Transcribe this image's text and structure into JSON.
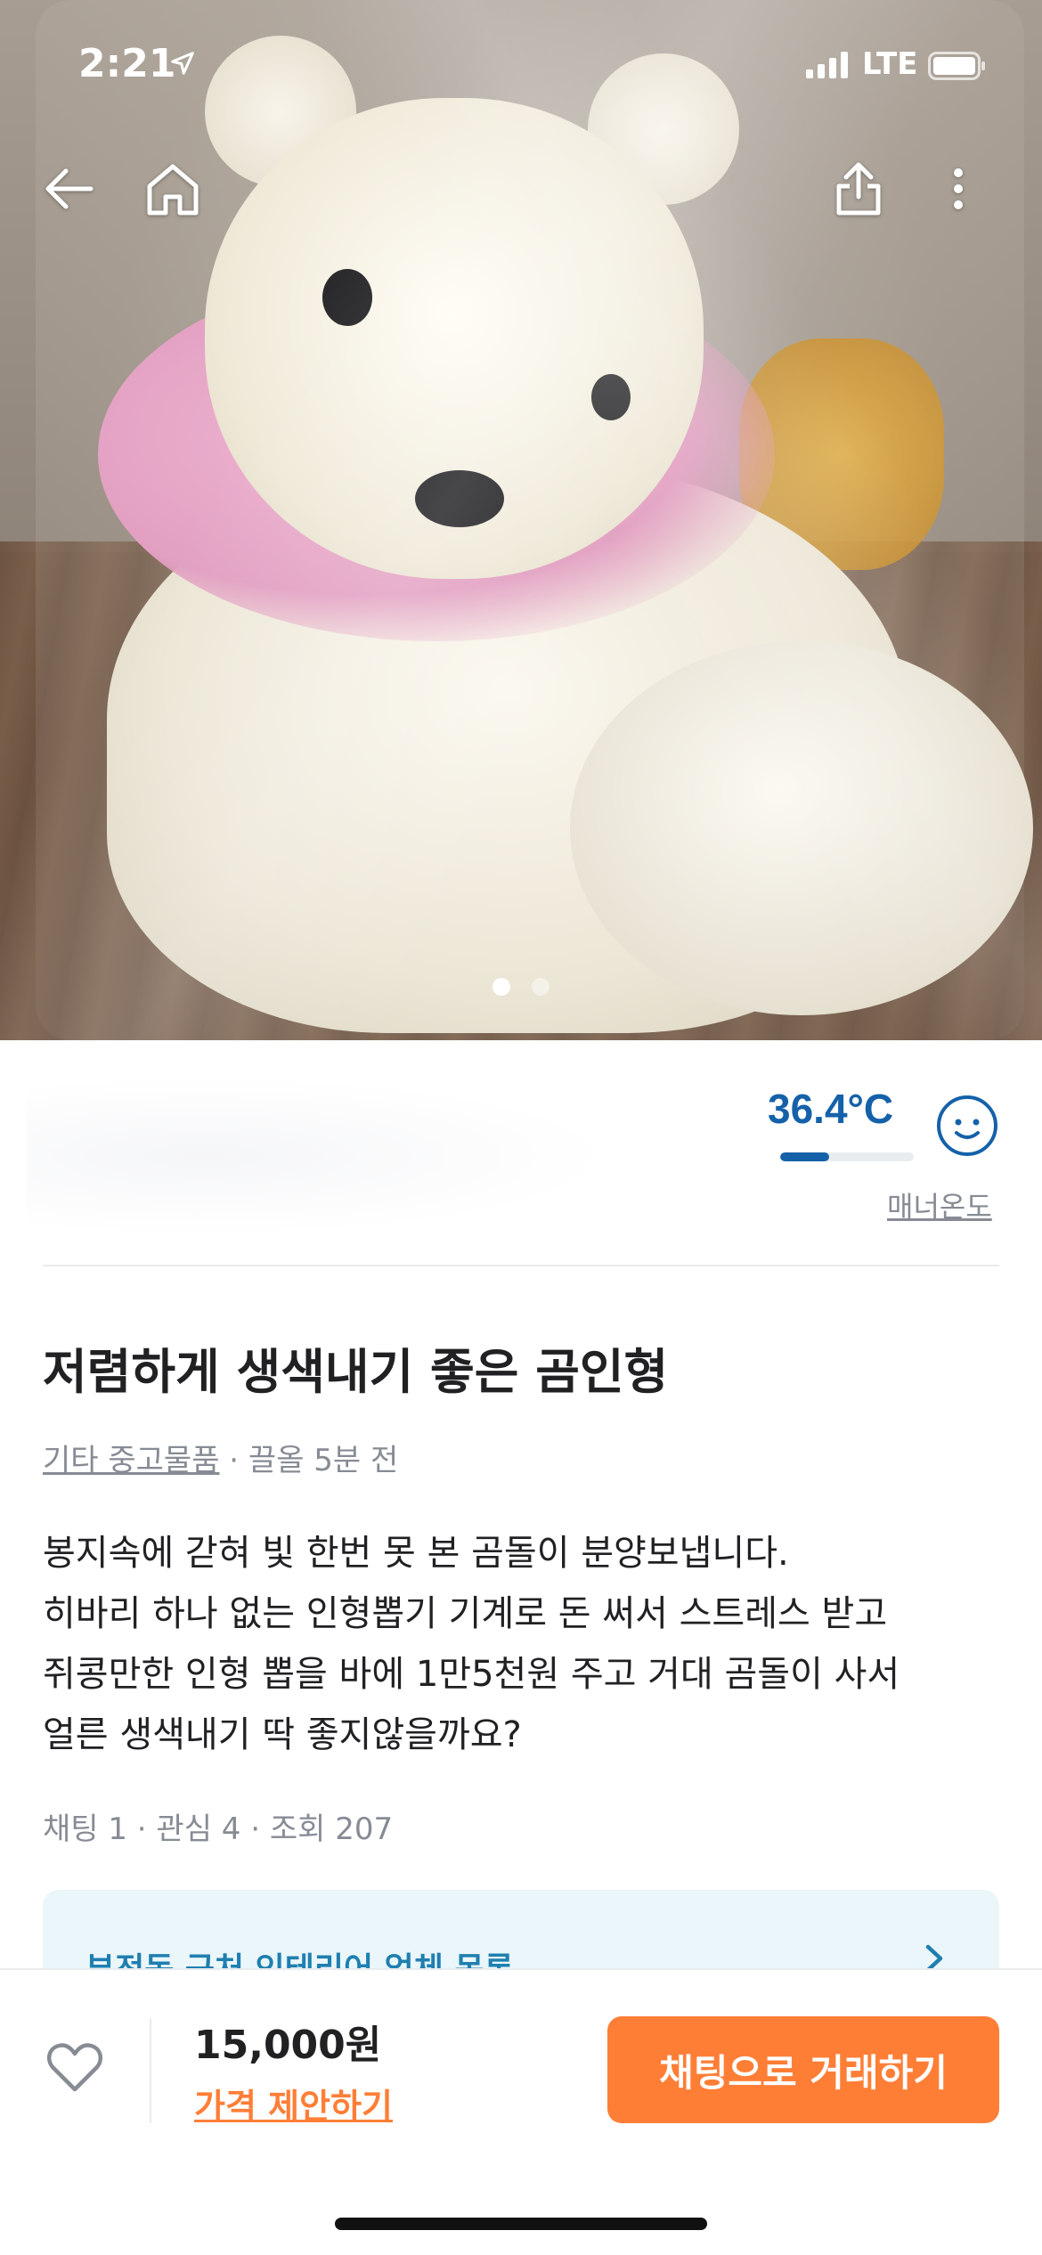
{
  "status_bar": {
    "time": "2:21",
    "network": "LTE"
  },
  "photo": {
    "total": 2,
    "current": 1
  },
  "seller": {
    "temperature": "36.4°C",
    "temperature_level": 36.4,
    "manner_label": "매너온도"
  },
  "post": {
    "title": "저렴하게 생색내기 좋은 곰인형",
    "category": "기타 중고물품",
    "time_meta": " · 끌올 5분 전",
    "description": [
      "봉지속에 갇혀 빛 한번 못 본 곰돌이 분양보냅니다.",
      "히바리 하나 없는 인형뽑기 기계로 돈 써서 스트레스 받고",
      "쥐콩만한 인형 뽑을 바에 1만5천원 주고 거대 곰돌이 사서",
      "얼른 생색내기 딱 좋지않을까요?"
    ],
    "stats": "채팅 1 · 관심 4 · 조회 207"
  },
  "banner": {
    "text": "부전동 근처 인테리어 업체 목록"
  },
  "bottom_bar": {
    "price": "15,000원",
    "offer_label": "가격 제안하기",
    "cta_label": "채팅으로 거래하기"
  },
  "colors": {
    "accent": "#ff7e36",
    "temperature": "#1561a9"
  }
}
